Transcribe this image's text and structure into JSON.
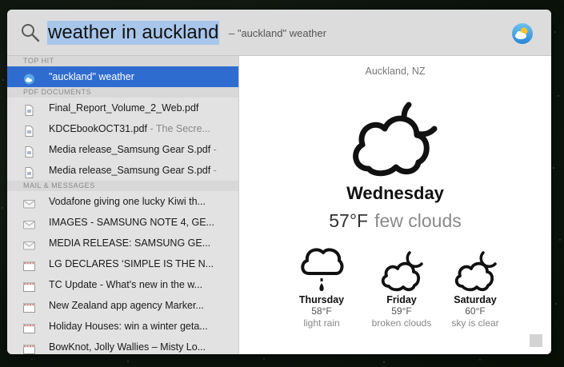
{
  "search": {
    "query": "weather in auckland",
    "suggestion": "– \"auckland\" weather"
  },
  "sidebar": {
    "sections": [
      {
        "header": "TOP HIT",
        "items": [
          {
            "label": "\"auckland\" weather",
            "sub": "",
            "icon": "weather-icon",
            "selected": true
          }
        ]
      },
      {
        "header": "PDF DOCUMENTS",
        "items": [
          {
            "label": "Final_Report_Volume_2_Web.pdf",
            "sub": "",
            "icon": "pdf-icon"
          },
          {
            "label": "KDCEbookOCT31.pdf",
            "sub": " - The Secre...",
            "icon": "pdf-icon"
          },
          {
            "label": "Media release_Samsung Gear S.pdf",
            "sub": " -",
            "icon": "pdf-icon"
          },
          {
            "label": "Media release_Samsung Gear S.pdf",
            "sub": " -",
            "icon": "pdf-icon"
          }
        ]
      },
      {
        "header": "MAIL & MESSAGES",
        "items": [
          {
            "label": "Vodafone giving one lucky Kiwi th...",
            "sub": "",
            "icon": "mail-icon"
          },
          {
            "label": "IMAGES - SAMSUNG NOTE 4, GE...",
            "sub": "",
            "icon": "mail-icon"
          },
          {
            "label": "MEDIA RELEASE: SAMSUNG GE...",
            "sub": "",
            "icon": "mail-icon"
          },
          {
            "label": "LG DECLARES ‘SIMPLE IS THE N...",
            "sub": "",
            "icon": "mail-dashed-icon"
          },
          {
            "label": "TC Update - What's new in the w...",
            "sub": "",
            "icon": "mail-dashed-icon"
          },
          {
            "label": "New Zealand app agency Marker...",
            "sub": "",
            "icon": "mail-dashed-icon"
          },
          {
            "label": "Holiday Houses: win a winter geta...",
            "sub": "",
            "icon": "mail-dashed-icon"
          },
          {
            "label": "BowKnot, Jolly Wallies – Misty Lo...",
            "sub": "",
            "icon": "mail-dashed-icon"
          }
        ]
      }
    ]
  },
  "preview": {
    "location": "Auckland, NZ",
    "day": "Wednesday",
    "temp": "57°F",
    "condition": "few clouds",
    "forecast": [
      {
        "day": "Thursday",
        "temp": "58°F",
        "condition": "light rain",
        "icon": "rain-cloud-icon"
      },
      {
        "day": "Friday",
        "temp": "59°F",
        "condition": "broken clouds",
        "icon": "cloud-moon-icon"
      },
      {
        "day": "Saturday",
        "temp": "60°F",
        "condition": "sky is clear",
        "icon": "cloud-moon-icon"
      }
    ]
  },
  "colors": {
    "selection": "#2f6cd0",
    "query_highlight": "#a8c6ea"
  }
}
